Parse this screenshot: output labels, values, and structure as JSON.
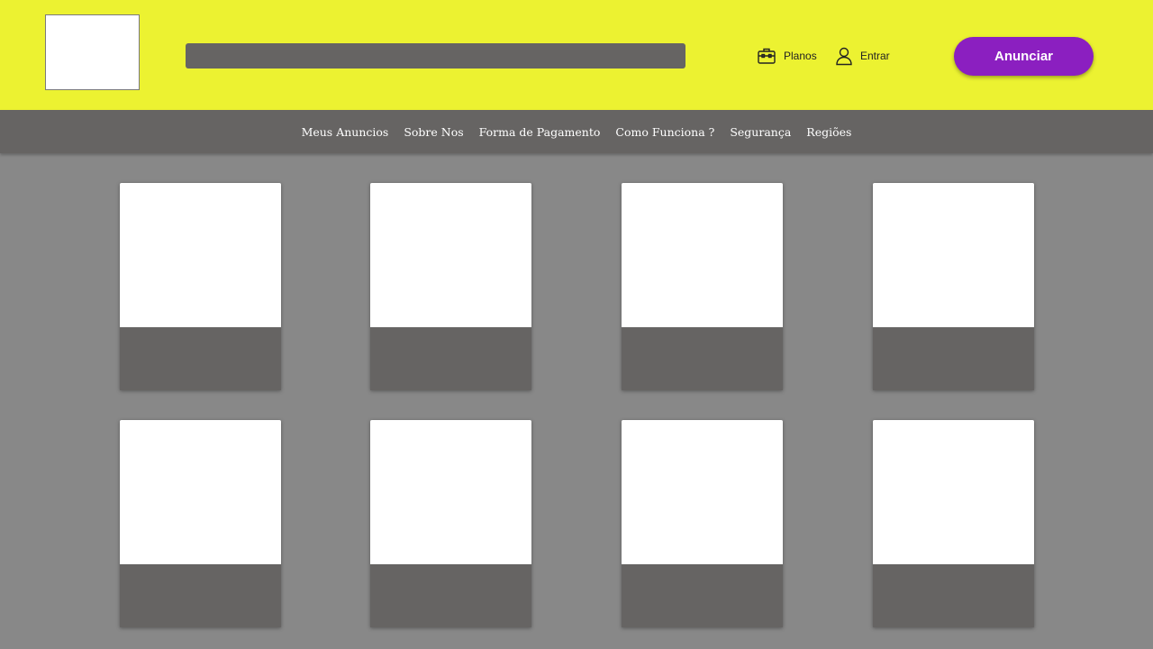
{
  "header": {
    "background": "#ecf231",
    "search": {
      "value": "",
      "placeholder": ""
    },
    "links": [
      {
        "label": "Planos",
        "icon": "briefcase-icon"
      },
      {
        "label": "Entrar",
        "icon": "user-icon"
      }
    ],
    "cta": {
      "label": "Anunciar",
      "color": "#8b1fc0"
    }
  },
  "nav": {
    "background": "#666463",
    "items": [
      "Meus Anuncios",
      "Sobre Nos",
      "Forma de Pagamento",
      "Como Funciona ?",
      "Segurança",
      "Regiões"
    ]
  },
  "listings": {
    "count": 8,
    "card_image_color": "#ffffff",
    "card_footer_color": "#666463"
  }
}
